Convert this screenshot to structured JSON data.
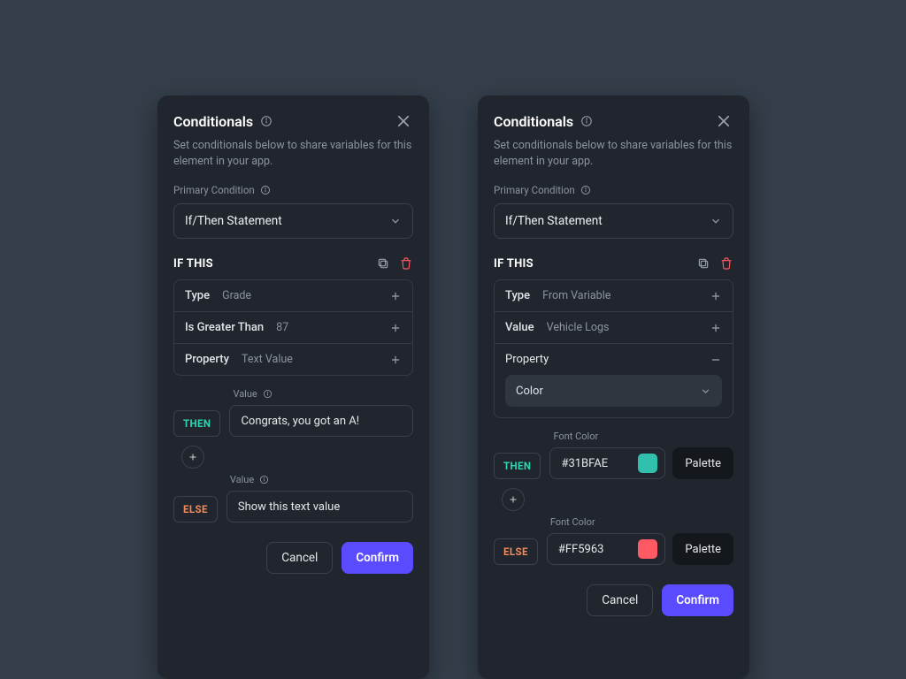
{
  "common": {
    "title": "Conditionals",
    "subtitle": "Set conditionals below to share variables for this element in your app.",
    "primary_condition_label": "Primary Condition",
    "statement": "If/Then Statement",
    "if_this": "IF THIS",
    "then": "THEN",
    "else": "ELSE",
    "cancel": "Cancel",
    "confirm": "Confirm",
    "value_label": "Value",
    "font_color_label": "Font Color",
    "palette": "Palette"
  },
  "panelA": {
    "rows": [
      {
        "k": "Type",
        "v": "Grade"
      },
      {
        "k": "Is Greater Than",
        "v": "87"
      },
      {
        "k": "Property",
        "v": "Text Value"
      }
    ],
    "then_value": "Congrats, you got an A!",
    "else_value": "Show this text value"
  },
  "panelB": {
    "rows": [
      {
        "k": "Type",
        "v": "From Variable"
      },
      {
        "k": "Value",
        "v": "Vehicle Logs"
      }
    ],
    "property_label": "Property",
    "property_value": "Color",
    "then_color": "#31BFAE",
    "else_color": "#FF5963"
  },
  "colors": {
    "accent": "#5a4bff",
    "then": "#2fd6b3",
    "else": "#f28b5b",
    "trash": "#ff5963"
  }
}
